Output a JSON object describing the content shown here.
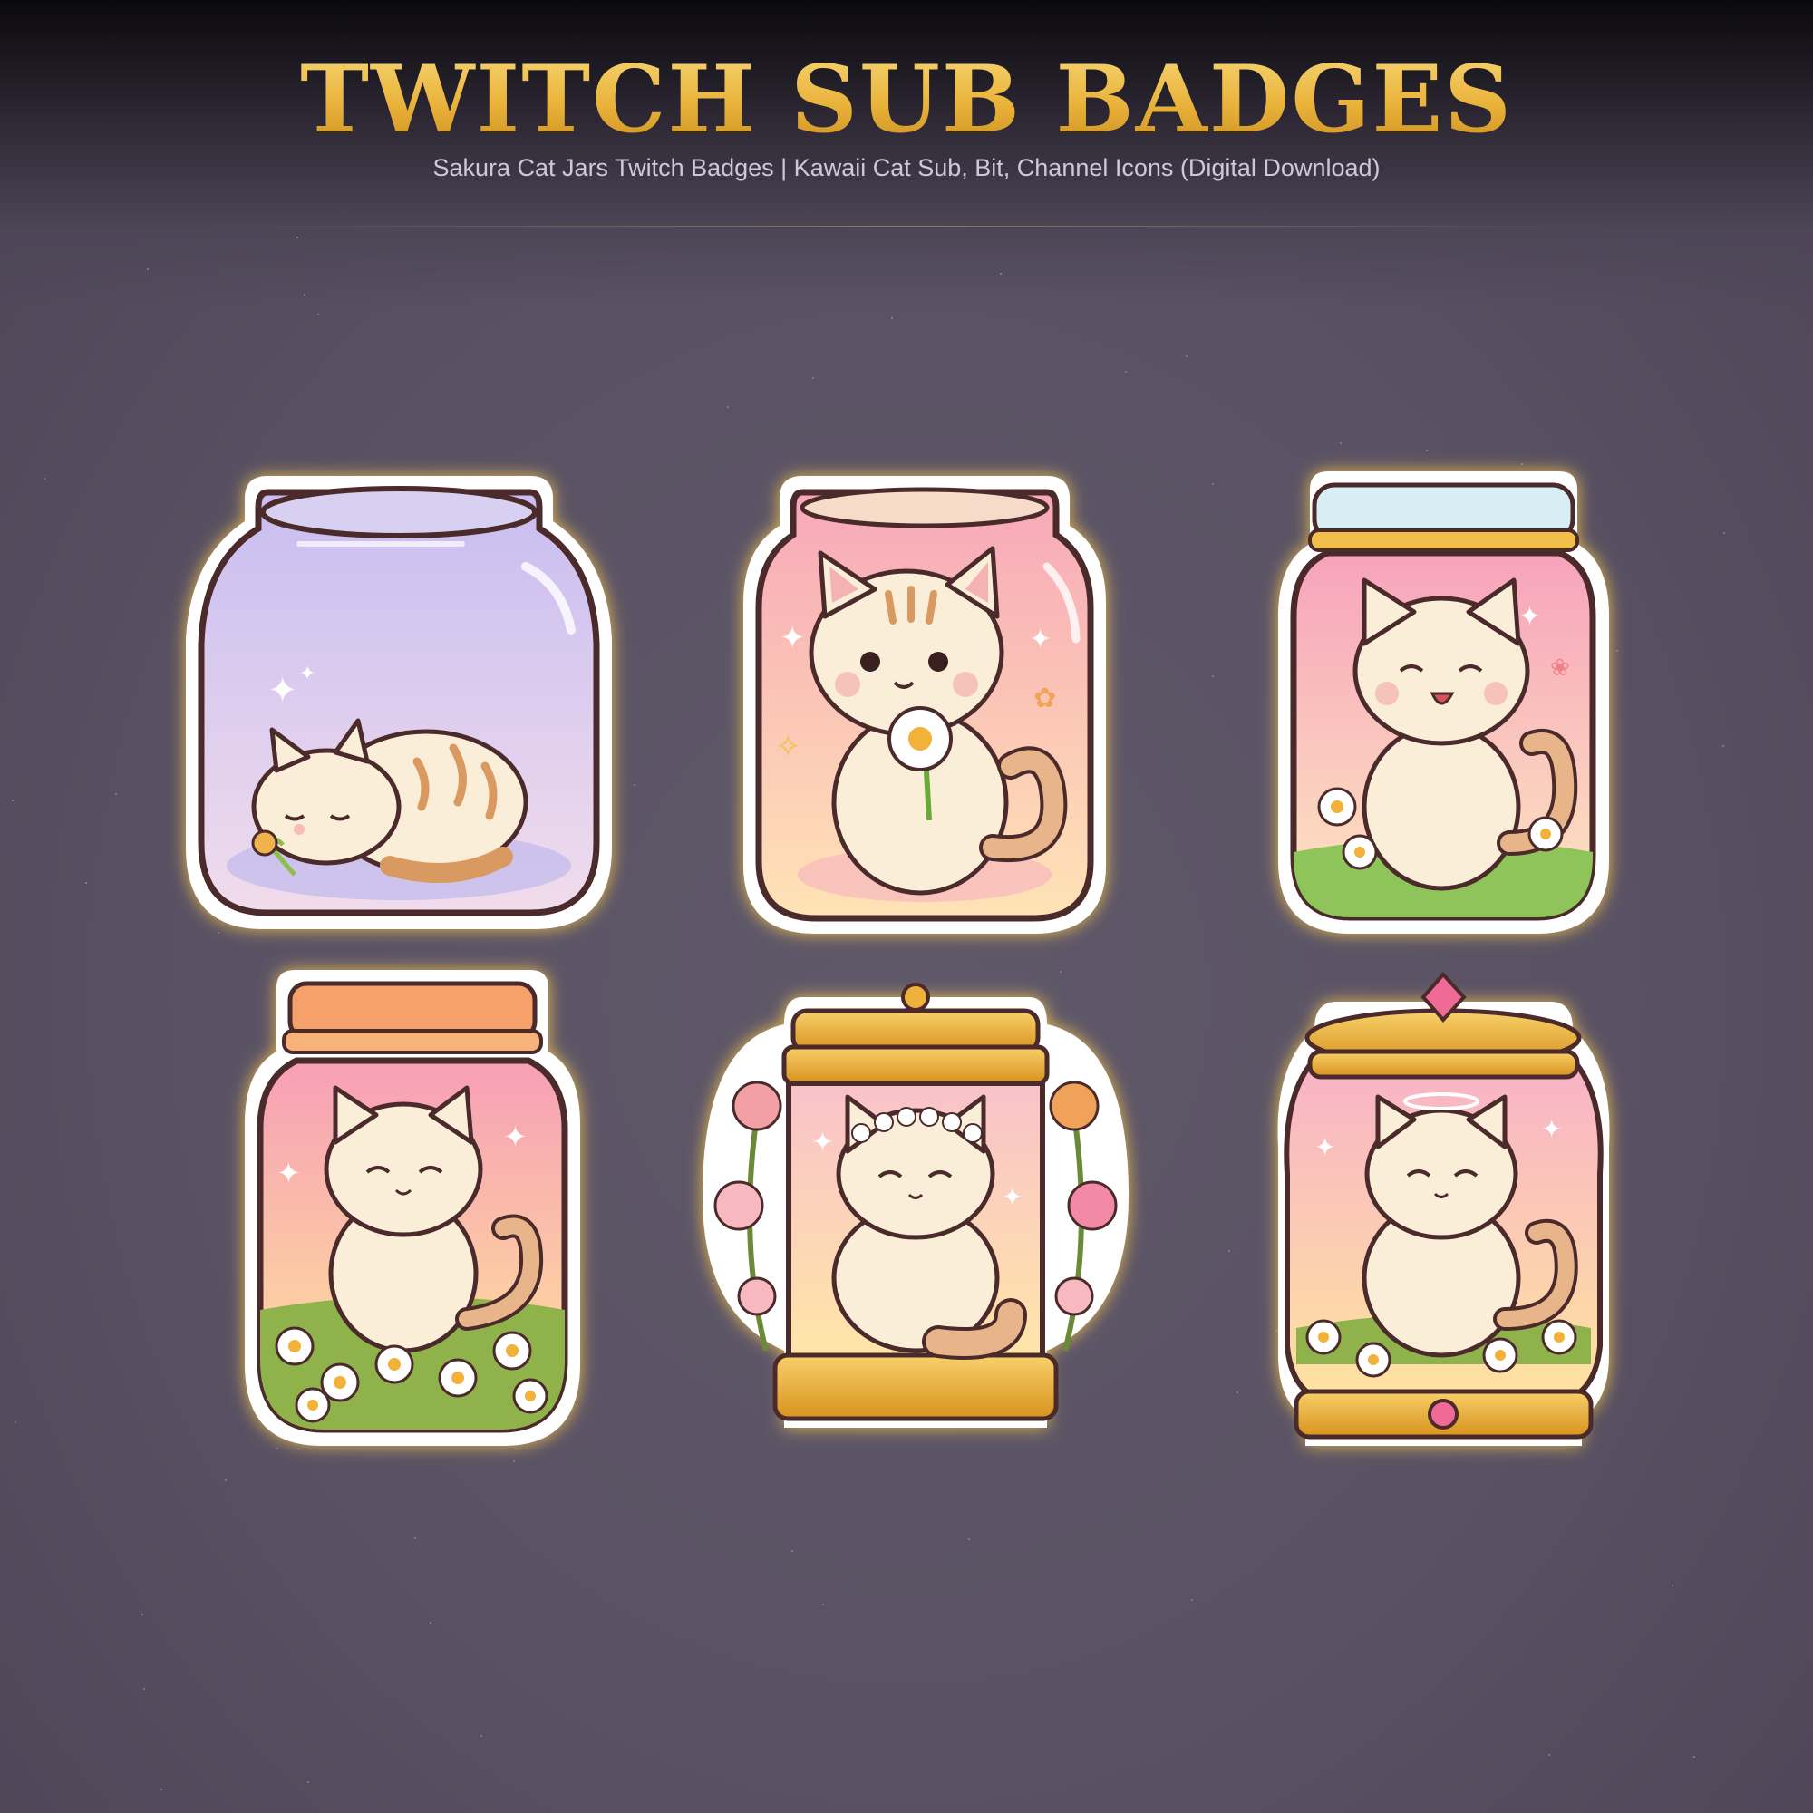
{
  "header": {
    "title": "TWITCH SUB BADGES",
    "subtitle": "Sakura Cat Jars Twitch Badges | Kawaii Cat Sub, Bit, Channel Icons (Digital Download)"
  },
  "colors": {
    "background": "#5a5264",
    "title_gold": "#e9b23a",
    "outline": "#4a2a2a",
    "fur": "#fbeed8",
    "stripe": "#d99a62"
  },
  "badges": [
    {
      "name": "sleeping-cat-jar-badge",
      "jar_top": "#c8bdf0",
      "jar_bottom": "#f1dcec",
      "lid": "#d8d0f0",
      "pose": "sleeping"
    },
    {
      "name": "daisy-cat-jar-badge",
      "jar_top": "#f7a8b8",
      "jar_bottom": "#ffe3b5",
      "lid": "#f6dcc8",
      "pose": "holding-flower"
    },
    {
      "name": "meadow-cat-jar-badge",
      "jar_top": "#f7a3bb",
      "jar_bottom": "#fde6c0",
      "lid": "#d6eef4",
      "pose": "laughing"
    },
    {
      "name": "flower-field-cat-jar-badge",
      "jar_top": "#f79fb6",
      "jar_bottom": "#ffe59a",
      "lid": "#f6a06a",
      "pose": "smiling"
    },
    {
      "name": "golden-crowned-cat-jar-badge",
      "jar_top": "#f9c2c9",
      "jar_bottom": "#ffe6a8",
      "lid": "#e9aa35",
      "pose": "flower-crown"
    },
    {
      "name": "jeweled-cat-jar-badge",
      "jar_top": "#f8b3c6",
      "jar_bottom": "#ffe3a0",
      "lid": "#eeb23c",
      "pose": "serene"
    }
  ]
}
